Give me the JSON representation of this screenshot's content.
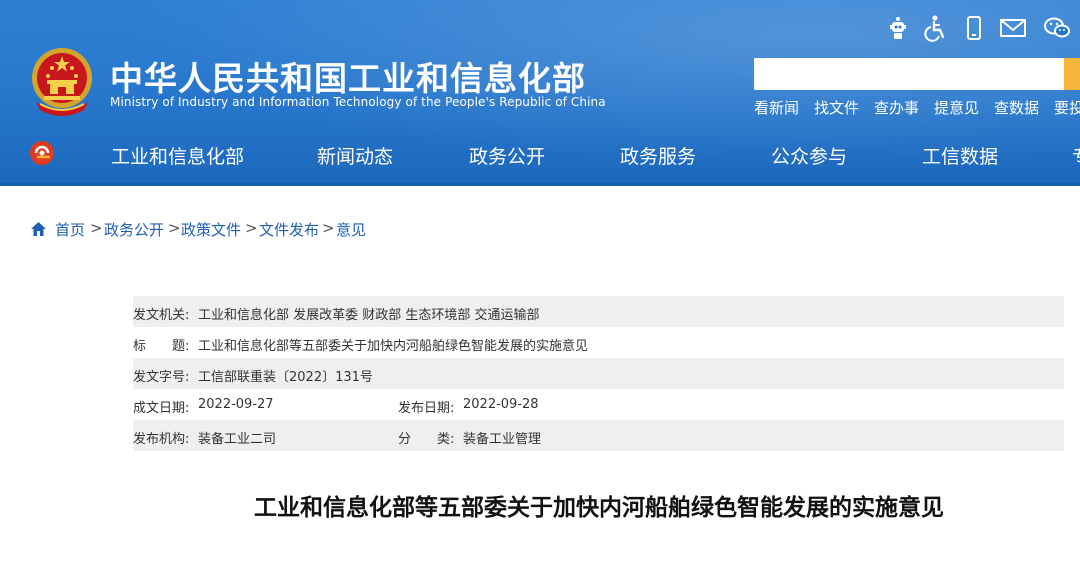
{
  "header": {
    "title_cn": "中华人民共和国工业和信息化部",
    "title_en": "Ministry of Industry and Information Technology of the People's Republic of China",
    "utility_icons": [
      "robot-assistant-icon",
      "accessibility-icon",
      "mobile-icon",
      "mail-icon",
      "wechat-icon"
    ],
    "search": {
      "value": "",
      "placeholder": ""
    },
    "quick_links": [
      "看新闻",
      "找文件",
      "查办事",
      "提意见",
      "查数据",
      "要投"
    ]
  },
  "nav": {
    "items": [
      "工业和信息化部",
      "新闻动态",
      "政务公开",
      "政务服务",
      "公众参与",
      "工信数据",
      "专"
    ]
  },
  "breadcrumb": {
    "items": [
      "首页",
      "政务公开",
      "政策文件",
      "文件发布",
      "意见"
    ],
    "separator": ">"
  },
  "meta": {
    "issuer_label": "发文机关:",
    "issuer_value": "工业和信息化部 发展改革委 财政部 生态环境部 交通运输部",
    "title_label": "标　　题:",
    "title_value": "工业和信息化部等五部委关于加快内河船舶绿色智能发展的实施意见",
    "doc_no_label": "发文字号:",
    "doc_no_value": "工信部联重装〔2022〕131号",
    "written_date_label": "成文日期:",
    "written_date_value": "2022-09-27",
    "publish_date_label": "发布日期:",
    "publish_date_value": "2022-09-28",
    "org_label": "发布机构:",
    "org_value": "装备工业二司",
    "category_label": "分　　类:",
    "category_value": "装备工业管理"
  },
  "article": {
    "title": "工业和信息化部等五部委关于加快内河船舶绿色智能发展的实施意见"
  },
  "colors": {
    "header_blue": "#2676cc",
    "search_button": "#f5b73b",
    "link_blue": "#1f5fb6",
    "row_shade": "#efefef"
  }
}
